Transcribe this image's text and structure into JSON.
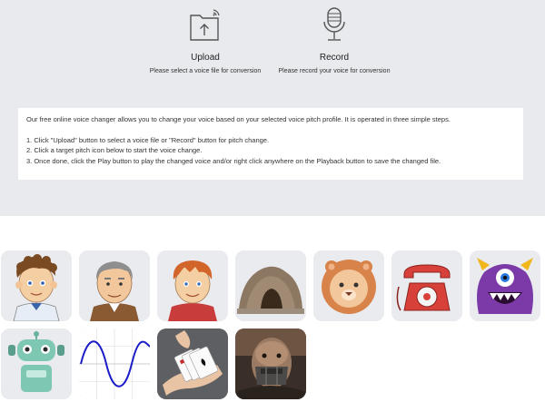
{
  "upload": {
    "label": "Upload",
    "description": "Please select a voice file for conversion",
    "icon": "folder-upload-icon"
  },
  "record": {
    "label": "Record",
    "description": "Please record your voice for conversion",
    "icon": "microphone-icon"
  },
  "info": {
    "intro": "Our free online voice changer allows you to change your voice based on your selected voice pitch profile. It is operated in three simple steps.",
    "steps": [
      "1. Click \"Upload\" button to select a voice file or \"Record\" button for pitch change.",
      "2. Click a target pitch icon below to start the voice change.",
      "3. Once done, click the Play button to play the changed voice and/or right click anywhere on the Playback button to save the changed file."
    ]
  },
  "pitch_icons": [
    {
      "name": "boy-curly-hair-icon"
    },
    {
      "name": "old-man-icon"
    },
    {
      "name": "red-hair-boy-icon"
    },
    {
      "name": "cave-icon"
    },
    {
      "name": "lion-icon"
    },
    {
      "name": "telephone-icon"
    },
    {
      "name": "purple-monster-icon"
    },
    {
      "name": "robot-icon"
    },
    {
      "name": "sine-wave-icon"
    },
    {
      "name": "playing-cards-icon"
    },
    {
      "name": "masked-man-icon"
    }
  ]
}
